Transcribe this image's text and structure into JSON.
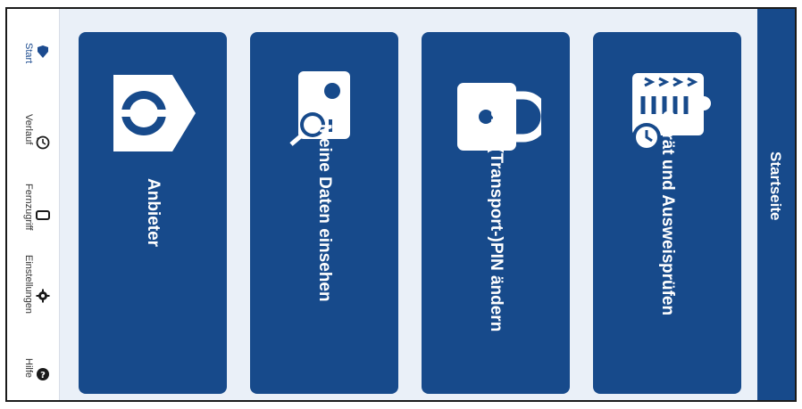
{
  "header": {
    "title": "Startseite"
  },
  "nav": {
    "items": [
      {
        "label": "Start",
        "icon": "home-arrow-icon",
        "active": true
      },
      {
        "label": "Verlauf",
        "icon": "history-icon"
      },
      {
        "label": "Fernzugriff",
        "icon": "phone-icon"
      },
      {
        "label": "Einstellungen",
        "icon": "gear-icon"
      },
      {
        "label": "Hilfe",
        "icon": "help-icon"
      }
    ]
  },
  "tiles": [
    {
      "label_line1": "Anbieter",
      "label_line2": "",
      "icon": "provider-icon"
    },
    {
      "label_line1": "Meine Daten einsehen",
      "label_line2": "",
      "icon": "id-card-search-icon"
    },
    {
      "label_line1": "Meine (Transport-)",
      "label_line2": "PIN ändern",
      "icon": "lock-icon"
    },
    {
      "label_line1": "Gerät und Ausweis",
      "label_line2": "prüfen",
      "icon": "device-check-icon"
    }
  ],
  "colors": {
    "brand": "#174a8b",
    "background": "#eaf0f8",
    "nav_active": "#1c4b8f"
  }
}
